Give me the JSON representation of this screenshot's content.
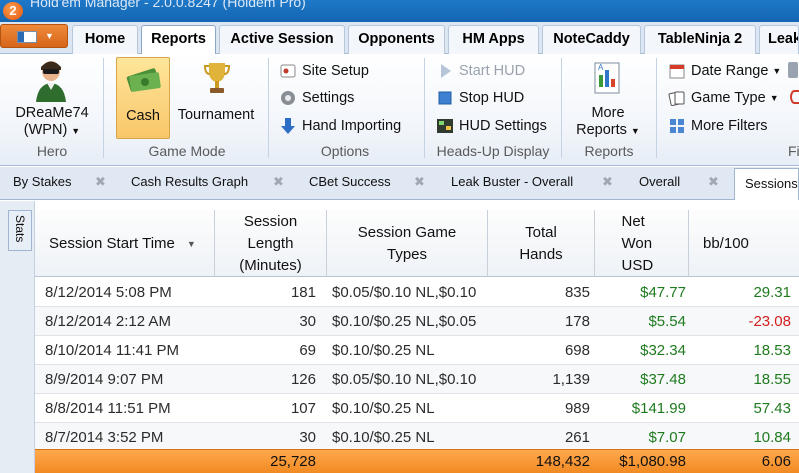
{
  "window": {
    "title": "Hold'em Manager - 2.0.0.8247 (Holdem Pro)",
    "logo": "2"
  },
  "ribbon_tabs": [
    {
      "label": "Home",
      "active": false
    },
    {
      "label": "Reports",
      "active": true
    },
    {
      "label": "Active Session",
      "active": false
    },
    {
      "label": "Opponents",
      "active": false
    },
    {
      "label": "HM Apps",
      "active": false
    },
    {
      "label": "NoteCaddy",
      "active": false
    },
    {
      "label": "TableNinja 2",
      "active": false
    },
    {
      "label": "Leak",
      "active": false
    }
  ],
  "ribbon": {
    "hero": {
      "name_line1": "DReaMe74",
      "name_line2": "(WPN)",
      "group": "Hero"
    },
    "game_mode": {
      "cash": "Cash",
      "tournament": "Tournament",
      "group": "Game Mode"
    },
    "options": {
      "site_setup": "Site Setup",
      "settings": "Settings",
      "hand_importing": "Hand Importing",
      "group": "Options"
    },
    "hud": {
      "start": "Start HUD",
      "stop": "Stop HUD",
      "settings": "HUD Settings",
      "group": "Heads-Up Display"
    },
    "reports": {
      "line1": "More",
      "line2": "Reports",
      "group": "Reports"
    },
    "filters": {
      "date_range": "Date Range",
      "game_type": "Game Type",
      "more_filters": "More Filters",
      "group": "Fi"
    }
  },
  "doc_tabs": [
    {
      "label": "By Stakes"
    },
    {
      "label": "Cash Results Graph"
    },
    {
      "label": "CBet Success"
    },
    {
      "label": "Leak Buster - Overall"
    },
    {
      "label": "Overall"
    },
    {
      "label": "Sessions",
      "active": true
    }
  ],
  "stats_tab": "Stats",
  "table": {
    "headers": [
      "Session Start Time",
      "Session Length (Minutes)",
      "Session Game Types",
      "Total Hands",
      "Net Won USD",
      "bb/100"
    ],
    "rows": [
      {
        "start": "8/12/2014 5:08 PM",
        "length": "181",
        "games": "$0.05/$0.10 NL,$0.10",
        "hands": "835",
        "net": "$47.77",
        "bb": "29.31",
        "sign": "pos"
      },
      {
        "start": "8/12/2014 2:12 AM",
        "length": "30",
        "games": "$0.10/$0.25 NL,$0.05",
        "hands": "178",
        "net": "$5.54",
        "bb": "-23.08",
        "sign": "neg"
      },
      {
        "start": "8/10/2014 11:41 PM",
        "length": "69",
        "games": "$0.10/$0.25 NL",
        "hands": "698",
        "net": "$32.34",
        "bb": "18.53",
        "sign": "pos"
      },
      {
        "start": "8/9/2014 9:07 PM",
        "length": "126",
        "games": "$0.05/$0.10 NL,$0.10",
        "hands": "1,139",
        "net": "$37.48",
        "bb": "18.55",
        "sign": "pos"
      },
      {
        "start": "8/8/2014 11:51 PM",
        "length": "107",
        "games": "$0.10/$0.25 NL",
        "hands": "989",
        "net": "$141.99",
        "bb": "57.43",
        "sign": "pos"
      },
      {
        "start": "8/7/2014 3:52 PM",
        "length": "30",
        "games": "$0.10/$0.25 NL",
        "hands": "261",
        "net": "$7.07",
        "bb": "10.84",
        "sign": "pos"
      }
    ],
    "totals": {
      "length": "25,728",
      "hands": "148,432",
      "net": "$1,080.98",
      "bb": "6.06"
    }
  },
  "colors": {
    "positive": "#1f7a1f",
    "negative": "#d31f1f",
    "totals_bar": "#f28a22",
    "title_bar": "#1466b2"
  }
}
